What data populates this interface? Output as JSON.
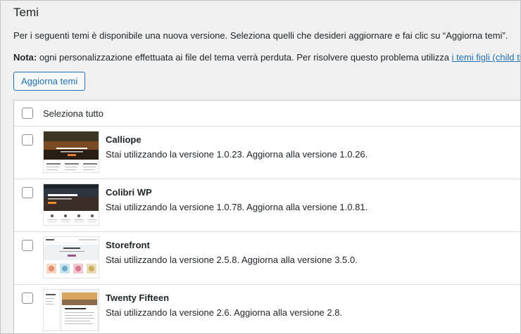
{
  "page": {
    "title": "Temi",
    "intro": "Per i seguenti temi è disponibile una nuova versione. Seleziona quelli che desideri aggiornare e fai clic su “Aggiorna temi”.",
    "note_label": "Nota:",
    "note_text": " ogni personalizzazione effettuata ai file del tema verrà perduta. Per risolvere questo problema utilizza ",
    "note_link": "i temi figli (child themes)",
    "note_end": ".",
    "update_button": "Aggiorna temi"
  },
  "table": {
    "select_all": "Seleziona tutto",
    "themes": [
      {
        "name": "Calliope",
        "description": "Stai utilizzando la versione 1.0.23. Aggiorna alla versione 1.0.26."
      },
      {
        "name": "Colibri WP",
        "description": "Stai utilizzando la versione 1.0.78. Aggiorna alla versione 1.0.81."
      },
      {
        "name": "Storefront",
        "description": "Stai utilizzando la versione 2.5.8. Aggiorna alla versione 3.5.0."
      },
      {
        "name": "Twenty Fifteen",
        "description": "Stai utilizzando la versione 2.6. Aggiorna alla versione 2.8."
      }
    ]
  },
  "colors": {
    "background": "#f0f0f1",
    "link": "#2271b1",
    "text": "#1d2327",
    "border": "#c3c4c7"
  }
}
